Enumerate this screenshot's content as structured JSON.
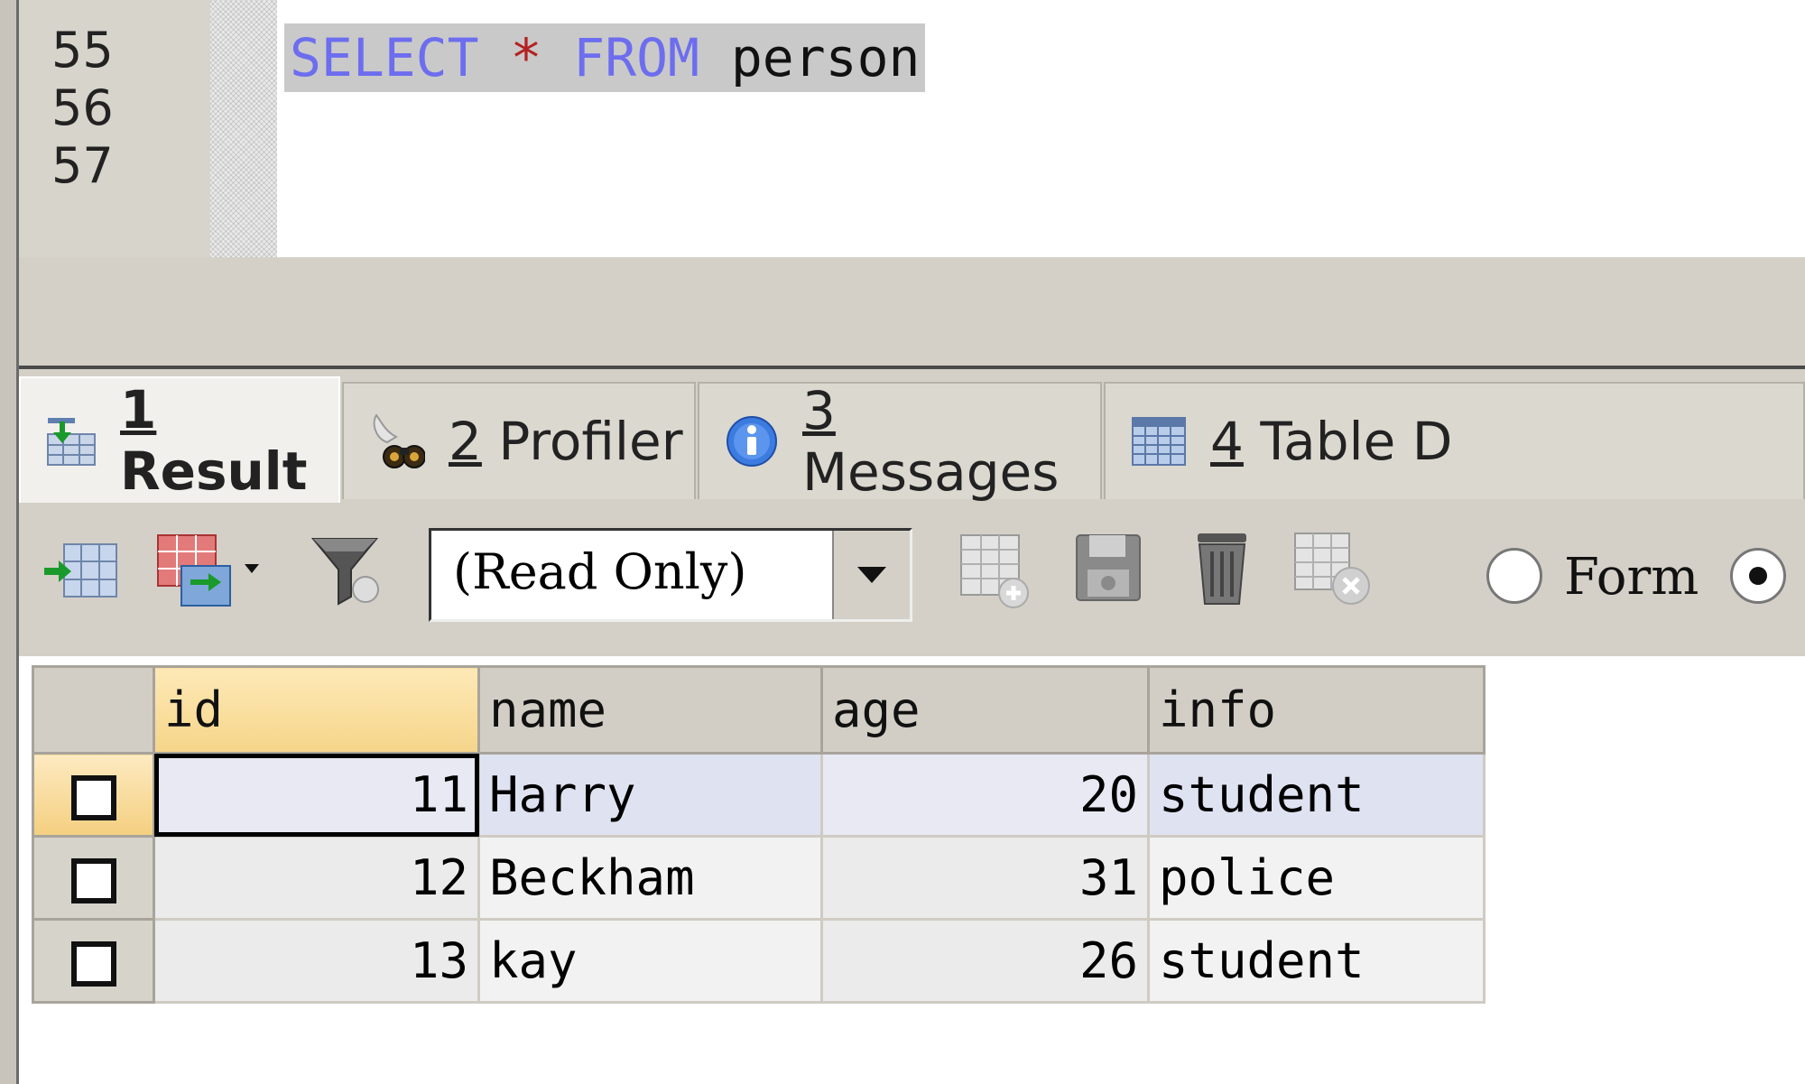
{
  "editor": {
    "line_numbers": [
      "55",
      "56",
      "57"
    ],
    "query": {
      "kw_select": "SELECT",
      "star": "*",
      "kw_from": "FROM",
      "table": "person"
    }
  },
  "tabs": [
    {
      "num": "1",
      "label": "Result",
      "icon": "result-grid-icon",
      "active": true
    },
    {
      "num": "2",
      "label": "Profiler",
      "icon": "profiler-icon",
      "active": false
    },
    {
      "num": "3",
      "label": "Messages",
      "icon": "info-icon",
      "active": false
    },
    {
      "num": "4",
      "label": "Table D",
      "icon": "table-data-icon",
      "active": false
    }
  ],
  "toolbar": {
    "mode_value": "(Read Only)",
    "buttons": [
      "export-icon",
      "export-menu-icon",
      "filter-icon",
      "add-row-icon",
      "save-icon",
      "delete-icon",
      "discard-icon"
    ],
    "radio_form_label": "Form",
    "radio_second_label": "("
  },
  "grid": {
    "columns": [
      "id",
      "name",
      "age",
      "info"
    ],
    "rows": [
      {
        "id": "11",
        "name": "Harry",
        "age": "20",
        "info": "student"
      },
      {
        "id": "12",
        "name": "Beckham",
        "age": "31",
        "info": "police"
      },
      {
        "id": "13",
        "name": "kay",
        "age": "26",
        "info": "student"
      }
    ]
  }
}
